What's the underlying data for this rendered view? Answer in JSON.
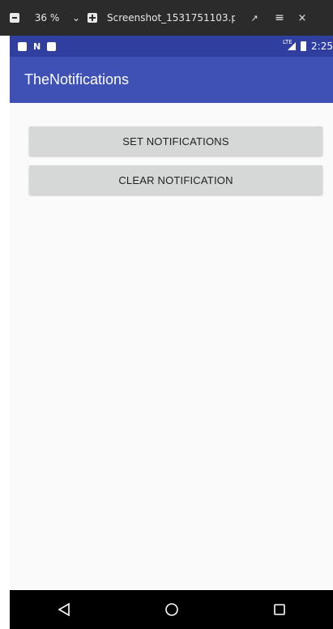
{
  "viewer": {
    "zoom": "36 %",
    "title": "Screenshot_1531751103.p...",
    "icons": [
      "menu-icon",
      "chevron-down-icon",
      "new-icon",
      "expand-icon",
      "hamburger-icon",
      "close-icon"
    ]
  },
  "status_bar": {
    "network": "LTE",
    "time": "2:25",
    "icons": [
      "sd-card-icon",
      "n-icon",
      "android-icon",
      "signal-icon",
      "battery-icon"
    ]
  },
  "app_bar": {
    "title": "TheNotifications"
  },
  "buttons": {
    "set_label": "SET NOTIFICATIONS",
    "clear_label": "CLEAR NOTIFICATION"
  },
  "nav_bar": {
    "icons": [
      "back-icon",
      "home-icon",
      "recents-icon"
    ]
  },
  "colors": {
    "status_bar": "#303f9f",
    "app_bar": "#3f51b5",
    "button": "#d6d7d7",
    "background": "#fafafa"
  }
}
